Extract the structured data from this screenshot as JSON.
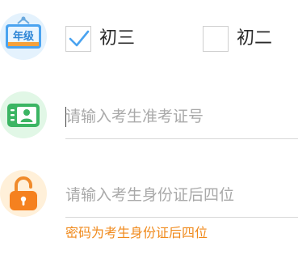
{
  "grade": {
    "options": [
      {
        "label": "初三",
        "checked": true
      },
      {
        "label": "初二",
        "checked": false
      }
    ],
    "badge_text": "年级"
  },
  "exam_number_field": {
    "placeholder": "请输入考生准考证号",
    "value": ""
  },
  "password_field": {
    "placeholder": "请输入考生身份证后四位",
    "value": ""
  },
  "password_hint": "密码为考生身份证后四位",
  "colors": {
    "accent_blue": "#4aa3f0",
    "accent_green": "#39b862",
    "accent_orange": "#f5811f",
    "hint_orange": "#f08a1c",
    "placeholder_gray": "#a9a9a9"
  },
  "icons": {
    "grade": "grade-badge-icon",
    "exam_id": "id-card-icon",
    "password": "padlock-icon"
  }
}
